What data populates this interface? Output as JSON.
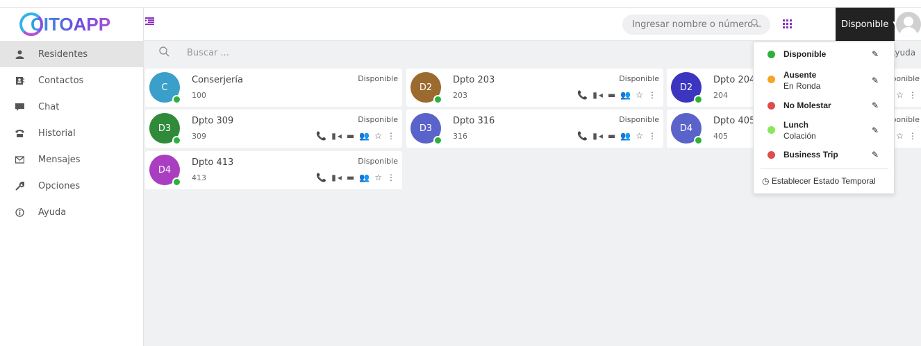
{
  "brand": {
    "logo_text": "CITOAPP"
  },
  "sidebar": {
    "items": [
      {
        "label": "Residentes",
        "icon": "user-icon"
      },
      {
        "label": "Contactos",
        "icon": "address-book-icon"
      },
      {
        "label": "Chat",
        "icon": "chat-icon"
      },
      {
        "label": "Historial",
        "icon": "phone-icon"
      },
      {
        "label": "Mensajes",
        "icon": "envelope-icon"
      },
      {
        "label": "Opciones",
        "icon": "wrench-icon"
      },
      {
        "label": "Ayuda",
        "icon": "info-icon"
      }
    ]
  },
  "header": {
    "search_placeholder": "Ingresar nombre o número...",
    "status_label": "Disponible"
  },
  "main": {
    "search_placeholder": "Buscar ...",
    "ayuda_label": "Ayuda"
  },
  "cards": [
    {
      "initials": "C",
      "name": "Conserjería",
      "ext": "100",
      "status": "Disponible",
      "color": "#3a9fc9"
    },
    {
      "initials": "D2",
      "name": "Dpto 203",
      "ext": "203",
      "status": "Disponible",
      "color": "#9b6a2f"
    },
    {
      "initials": "D2",
      "name": "Dpto 204",
      "ext": "204",
      "status": "Disponible",
      "color": "#3b35c0"
    },
    {
      "initials": "D3",
      "name": "Dpto 309",
      "ext": "309",
      "status": "Disponible",
      "color": "#2f8a3a"
    },
    {
      "initials": "D3",
      "name": "Dpto 316",
      "ext": "316",
      "status": "Disponible",
      "color": "#5a63c9"
    },
    {
      "initials": "D4",
      "name": "Dpto 405",
      "ext": "405",
      "status": "Disponible",
      "color": "#5a63c9"
    },
    {
      "initials": "D4",
      "name": "Dpto 413",
      "ext": "413",
      "status": "Disponible",
      "color": "#a93fc0"
    }
  ],
  "dropdown": {
    "items": [
      {
        "title": "Disponible",
        "sub": "",
        "color": "#2bb23a"
      },
      {
        "title": "Ausente",
        "sub": "En Ronda",
        "color": "#f5a623"
      },
      {
        "title": "No Molestar",
        "sub": "",
        "color": "#e04b4b"
      },
      {
        "title": "Lunch",
        "sub": "Colación",
        "color": "#86e85a"
      },
      {
        "title": "Business Trip",
        "sub": "",
        "color": "#e04b4b"
      }
    ],
    "temp_label": "Establecer Estado Temporal"
  }
}
